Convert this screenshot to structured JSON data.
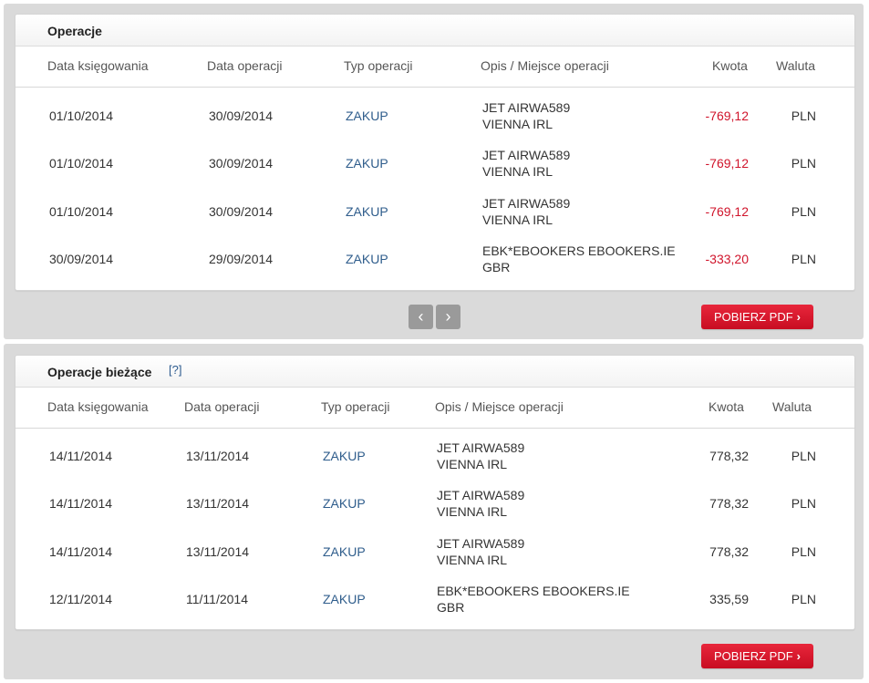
{
  "section1": {
    "title": "Operacje",
    "headers": [
      "Data księgowania",
      "Data operacji",
      "Typ operacji",
      "Opis / Miejsce operacji",
      "Kwota",
      "Waluta"
    ],
    "rows": [
      {
        "posting_date": "01/10/2014",
        "operation_date": "30/09/2014",
        "type": "ZAKUP",
        "desc_line1": "JET AIRWA589",
        "desc_line2": "VIENNA IRL",
        "amount": "-769,12",
        "currency": "PLN"
      },
      {
        "posting_date": "01/10/2014",
        "operation_date": "30/09/2014",
        "type": "ZAKUP",
        "desc_line1": "JET AIRWA589",
        "desc_line2": "VIENNA IRL",
        "amount": "-769,12",
        "currency": "PLN"
      },
      {
        "posting_date": "01/10/2014",
        "operation_date": "30/09/2014",
        "type": "ZAKUP",
        "desc_line1": "JET AIRWA589",
        "desc_line2": "VIENNA IRL",
        "amount": "-769,12",
        "currency": "PLN"
      },
      {
        "posting_date": "30/09/2014",
        "operation_date": "29/09/2014",
        "type": "ZAKUP",
        "desc_line1": "EBK*EBOOKERS EBOOKERS.IE",
        "desc_line2": "GBR",
        "amount": "-333,20",
        "currency": "PLN"
      }
    ],
    "pager_prev": "‹",
    "pager_next": "›",
    "pdf_label": "POBIERZ PDF",
    "pdf_chevron": "›"
  },
  "section2": {
    "title": "Operacje bieżące",
    "help": "[?]",
    "headers": [
      "Data księgowania",
      "Data operacji",
      "Typ operacji",
      "Opis / Miejsce operacji",
      "Kwota",
      "Waluta"
    ],
    "rows": [
      {
        "posting_date": "14/11/2014",
        "operation_date": "13/11/2014",
        "type": "ZAKUP",
        "desc_line1": "JET AIRWA589",
        "desc_line2": "VIENNA IRL",
        "amount": "778,32",
        "currency": "PLN"
      },
      {
        "posting_date": "14/11/2014",
        "operation_date": "13/11/2014",
        "type": "ZAKUP",
        "desc_line1": "JET AIRWA589",
        "desc_line2": "VIENNA IRL",
        "amount": "778,32",
        "currency": "PLN"
      },
      {
        "posting_date": "14/11/2014",
        "operation_date": "13/11/2014",
        "type": "ZAKUP",
        "desc_line1": "JET AIRWA589",
        "desc_line2": "VIENNA IRL",
        "amount": "778,32",
        "currency": "PLN"
      },
      {
        "posting_date": "12/11/2014",
        "operation_date": "11/11/2014",
        "type": "ZAKUP",
        "desc_line1": "EBK*EBOOKERS EBOOKERS.IE",
        "desc_line2": "GBR",
        "amount": "335,59",
        "currency": "PLN"
      }
    ],
    "pdf_label": "POBIERZ PDF",
    "pdf_chevron": "›"
  },
  "colors": {
    "accent_red": "#d0142b",
    "link_blue": "#2f5d8c",
    "panel_gray": "#dadada",
    "pager_gray": "#9a9a9a"
  }
}
